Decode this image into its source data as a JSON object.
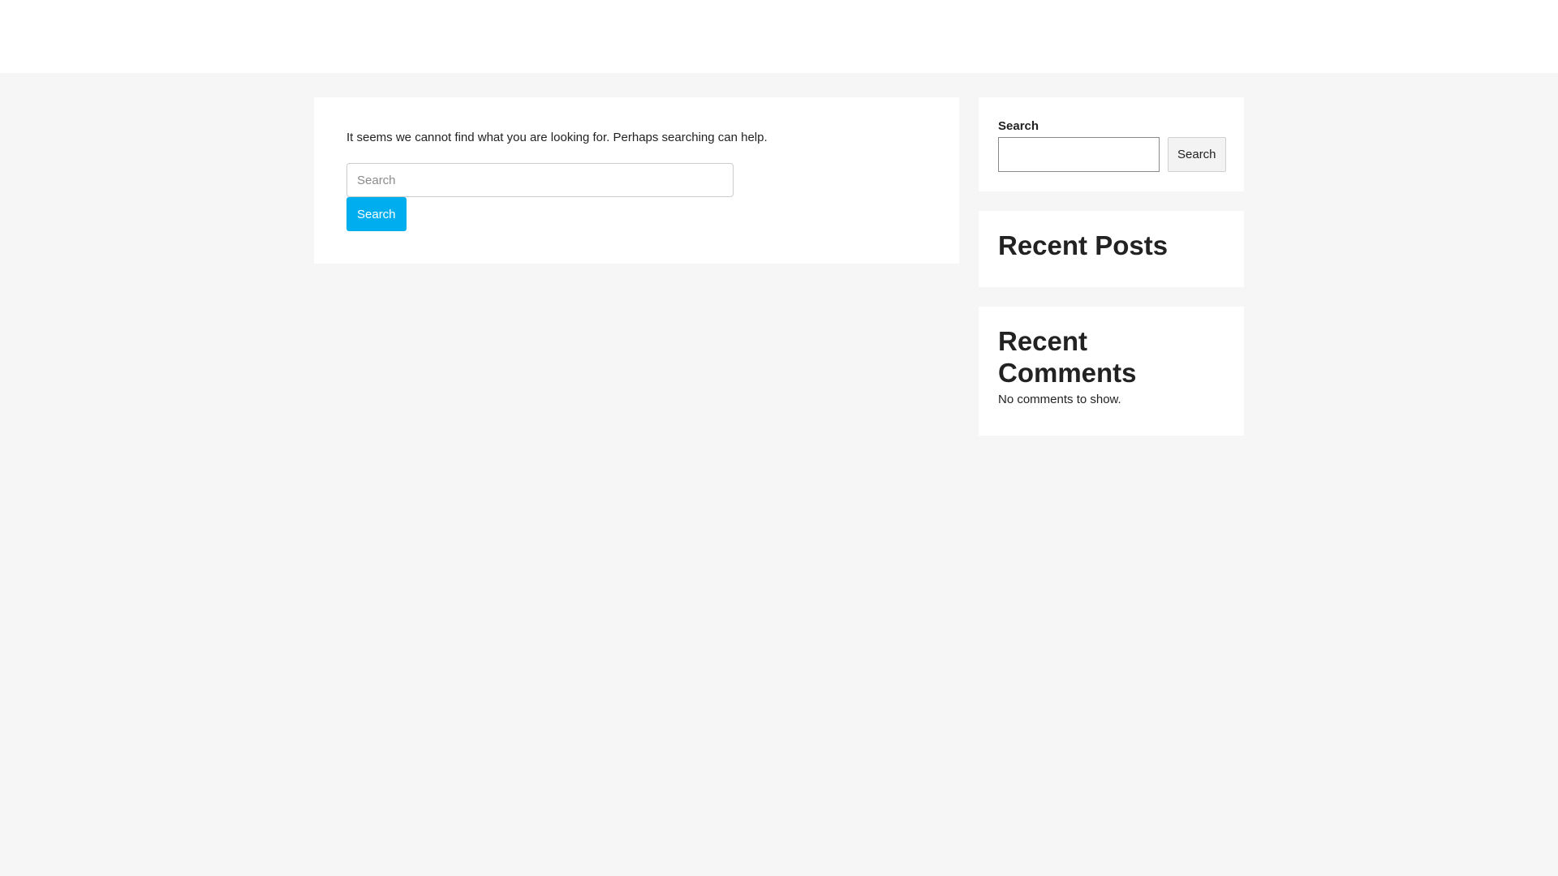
{
  "header": {},
  "main": {
    "message": "It seems we cannot find what you are looking for. Perhaps searching can help.",
    "search": {
      "placeholder": "Search",
      "value": "",
      "button_label": "Search"
    }
  },
  "sidebar": {
    "search_widget": {
      "label": "Search",
      "value": "",
      "button_label": "Search"
    },
    "recent_posts": {
      "title": "Recent Posts"
    },
    "recent_comments": {
      "title": "Recent Comments",
      "empty_text": "No comments to show."
    }
  },
  "colors": {
    "page_background": "#f6f6f6",
    "card_background": "#ffffff",
    "accent": "#00aeef",
    "text": "#222222"
  }
}
